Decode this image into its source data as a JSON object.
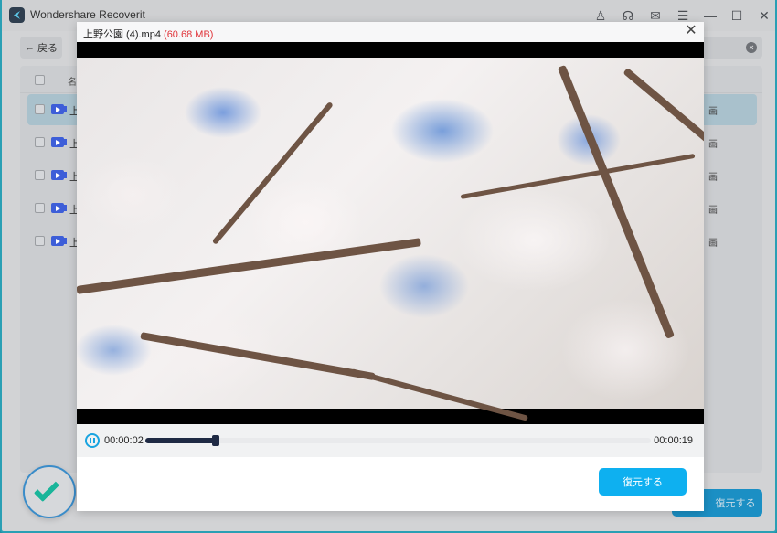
{
  "app": {
    "title": "Wondershare Recoverit",
    "titlebar_icons": [
      {
        "name": "account-icon",
        "glyph": "♙"
      },
      {
        "name": "headset-icon",
        "glyph": "☊"
      },
      {
        "name": "mail-icon",
        "glyph": "✉"
      },
      {
        "name": "menu-icon",
        "glyph": "☰"
      },
      {
        "name": "minimize-icon",
        "glyph": "—"
      },
      {
        "name": "maximize-icon",
        "glyph": "☐"
      },
      {
        "name": "close-icon",
        "glyph": "✕"
      }
    ]
  },
  "toolbar": {
    "back_label": "戻る",
    "back_icon": "←",
    "clear_icon": "×"
  },
  "list": {
    "header_name": "名",
    "rows": [
      {
        "name": "上",
        "tail": "画",
        "selected": true
      },
      {
        "name": "上",
        "tail": "画",
        "selected": false
      },
      {
        "name": "上",
        "tail": "画",
        "selected": false
      },
      {
        "name": "上",
        "tail": "画",
        "selected": false
      },
      {
        "name": "上",
        "tail": "画",
        "selected": false
      }
    ]
  },
  "bottom": {
    "recover_label": "復元する"
  },
  "preview": {
    "filename": "上野公園 (4).mp4",
    "filesize": "(60.68 MB)",
    "close_icon": "✕",
    "current_time": "00:00:02",
    "total_time": "00:00:19",
    "progress_percent": 14,
    "recover_label": "復元する",
    "image_description": "cherry blossoms against blue sky"
  },
  "colors": {
    "accent": "#0eb0f0",
    "filesize": "#e0353b",
    "progress": "#1f2a44",
    "check": "#1ab59a",
    "file_icon": "#3d5ed8"
  }
}
